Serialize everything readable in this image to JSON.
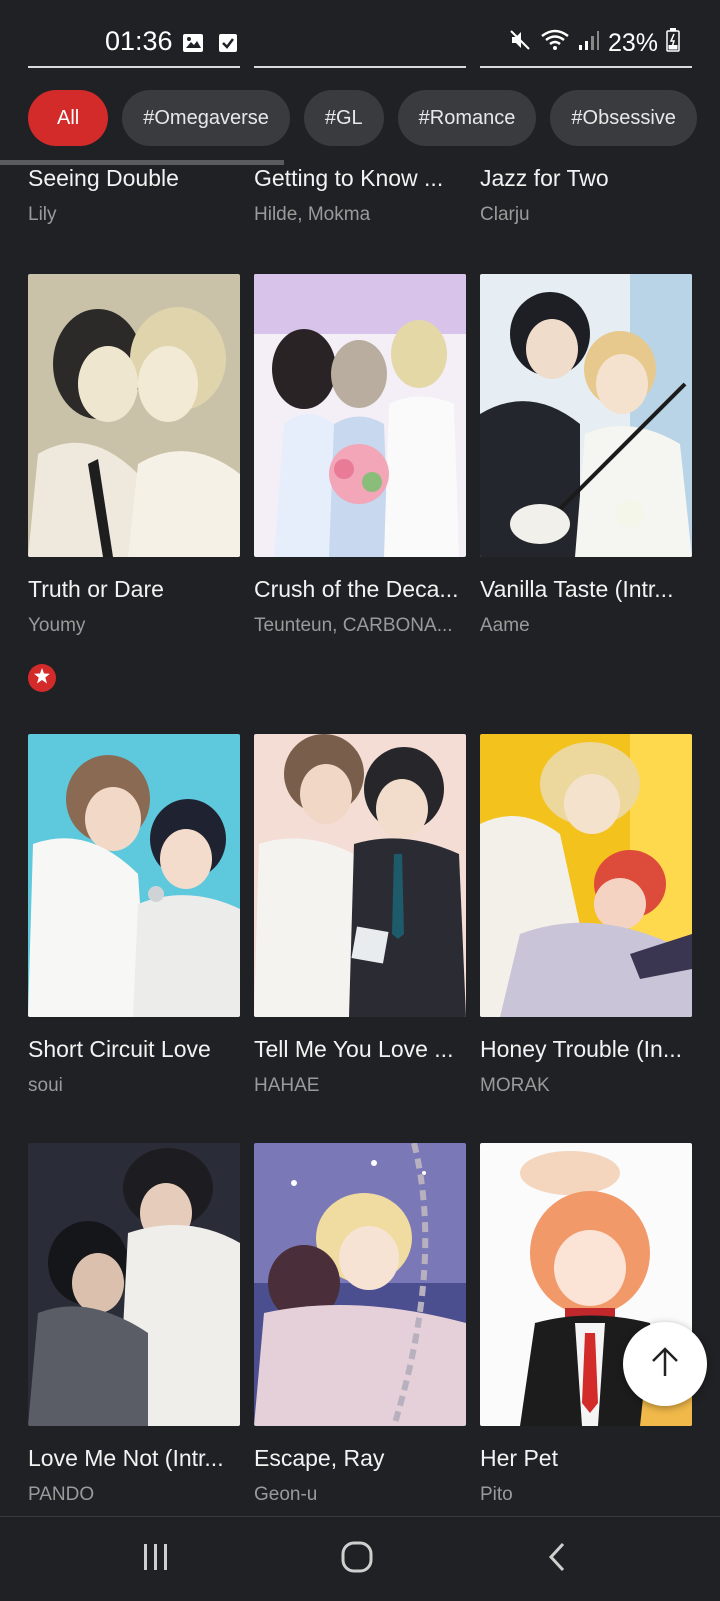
{
  "status_bar": {
    "time": "01:36",
    "battery": "23%",
    "icons": [
      "image-icon",
      "check-icon",
      "mute-icon",
      "wifi-icon",
      "signal-icon",
      "battery-icon"
    ]
  },
  "filters": {
    "chips": [
      "All",
      "#Omegaverse",
      "#GL",
      "#Romance",
      "#Obsessive"
    ],
    "active": "All"
  },
  "colors": {
    "accent": "#d32a2a",
    "background": "#202124",
    "chip": "#3a3b3e"
  },
  "rows": [
    {
      "items": [
        {
          "title": "Seeing Double",
          "author": "Lily"
        },
        {
          "title": "Getting to Know ...",
          "author": "Hilde, Mokma"
        },
        {
          "title": "Jazz for Two",
          "author": "Clarju"
        }
      ]
    },
    {
      "items": [
        {
          "title": "Truth or Dare",
          "author": "Youmy"
        },
        {
          "title": "Crush of the Deca...",
          "author": "Teunteun, CARBONA..."
        },
        {
          "title": "Vanilla Taste (Intr...",
          "author": "Aame"
        }
      ]
    },
    {
      "items": [
        {
          "title": "Short Circuit Love",
          "author": "soui"
        },
        {
          "title": "Tell Me You Love ...",
          "author": "HAHAE"
        },
        {
          "title": "Honey Trouble (In...",
          "author": "MORAK"
        }
      ]
    },
    {
      "items": [
        {
          "title": "Love Me Not (Intr...",
          "author": "PANDO"
        },
        {
          "title": "Escape, Ray",
          "author": "Geon-u"
        },
        {
          "title": "Her Pet",
          "author": "Pito"
        }
      ]
    }
  ],
  "badges": {
    "award_icon": "award-icon"
  },
  "fab": {
    "icon": "arrow-up-icon"
  },
  "nav": {
    "icons": [
      "recent-apps-icon",
      "home-icon",
      "back-icon"
    ]
  }
}
